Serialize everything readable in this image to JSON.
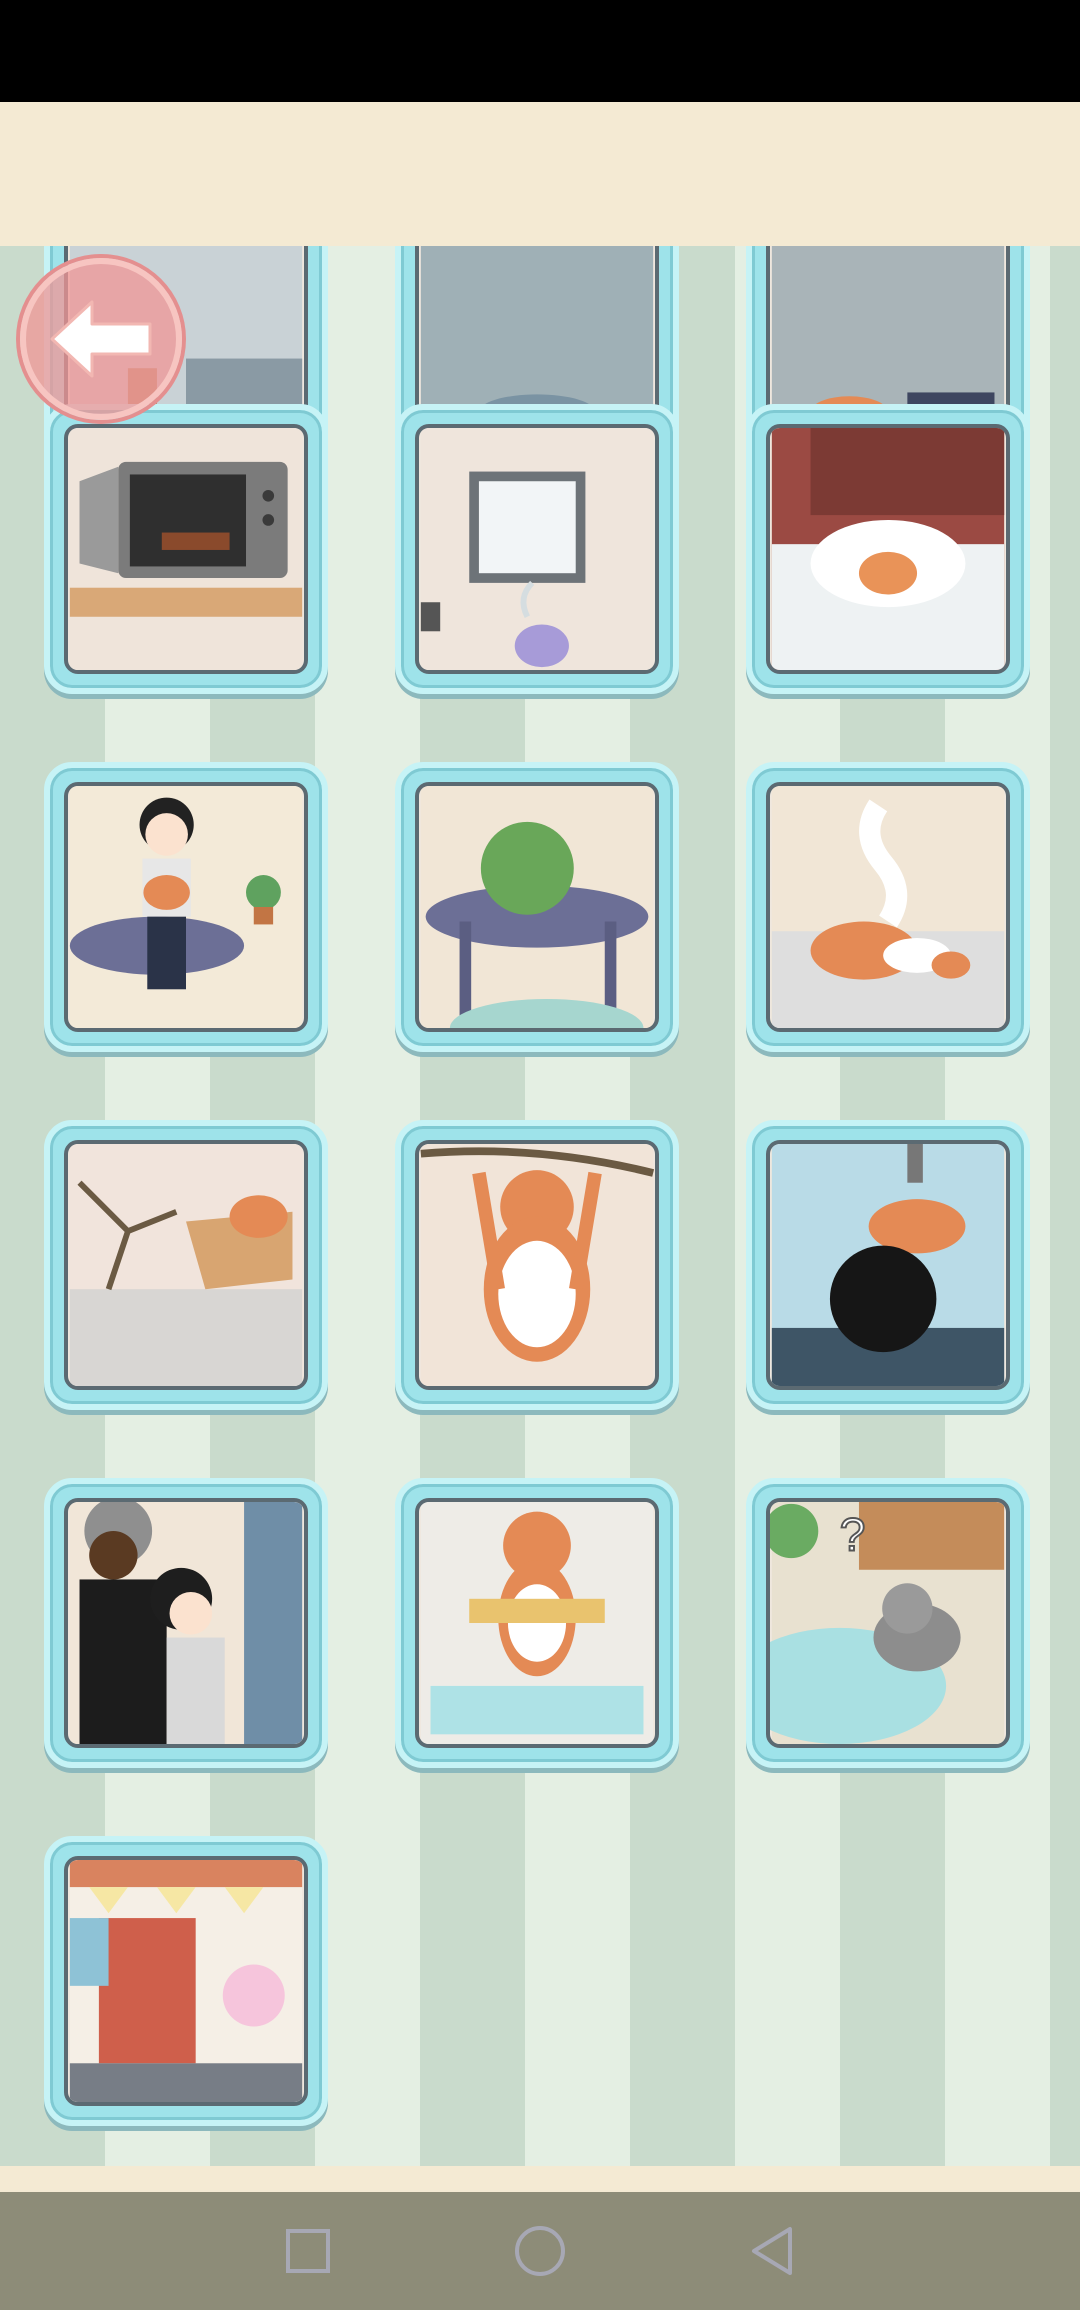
{
  "app": {
    "screen": "level-gallery"
  },
  "back_button": {
    "icon": "arrow-left-icon"
  },
  "levels": [
    {
      "scene": "partial-top-left"
    },
    {
      "scene": "partial-top-middle"
    },
    {
      "scene": "partial-top-right"
    },
    {
      "scene": "microwave-chocolate"
    },
    {
      "scene": "kettle-steam"
    },
    {
      "scene": "cat-in-snow"
    },
    {
      "scene": "boy-holding-cat"
    },
    {
      "scene": "green-fluffy-ball"
    },
    {
      "scene": "cat-ghost"
    },
    {
      "scene": "cat-in-box"
    },
    {
      "scene": "cat-hanging-branch"
    },
    {
      "scene": "claw-machine-cat"
    },
    {
      "scene": "guard-and-boy"
    },
    {
      "scene": "cat-with-towel"
    },
    {
      "scene": "raccoon-pond"
    },
    {
      "scene": "cotton-candy-vendor"
    }
  ],
  "navigation": {
    "recent_icon": "square-icon",
    "home_icon": "circle-icon",
    "back_icon": "triangle-back-icon"
  },
  "colors": {
    "header_bg": "#f4ead3",
    "card_frame": "#9ee3ea",
    "stripe_dark": "#c9dbcc",
    "stripe_light": "#e4efe3",
    "nav_bg": "#8d8c78"
  }
}
